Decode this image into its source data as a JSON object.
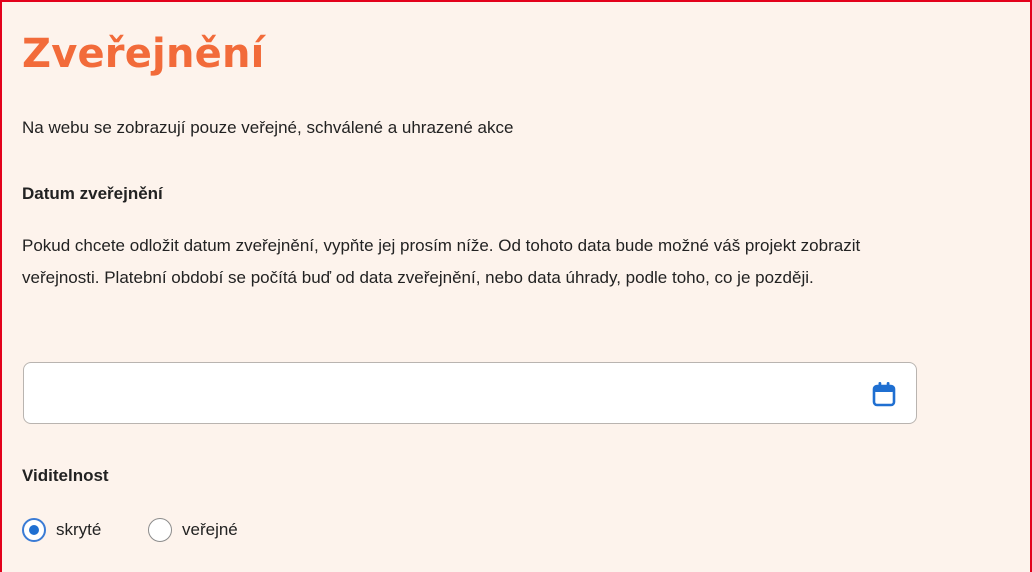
{
  "section": {
    "title": "Zveřejnění",
    "intro": "Na webu se zobrazují pouze veřejné, schválené a uhrazené akce"
  },
  "publish_date": {
    "label": "Datum zveřejnění",
    "help": "Pokud chcete odložit datum zveřejnění, vypňte jej prosím níže. Od tohoto data bude možné váš projekt zobrazit veřejnosti. Platební období se počítá buď od data zveřejnění, nebo data úhrady, podle toho, co je později.",
    "value": "",
    "icon": "calendar-icon"
  },
  "visibility": {
    "label": "Viditelnost",
    "options": [
      {
        "label": "skryté",
        "checked": true
      },
      {
        "label": "veřejné",
        "checked": false
      }
    ]
  },
  "colors": {
    "title": "#f26b3a",
    "panel_background": "#fdf3ec",
    "frame": "#e3001b",
    "accent": "#1f6fd1"
  }
}
